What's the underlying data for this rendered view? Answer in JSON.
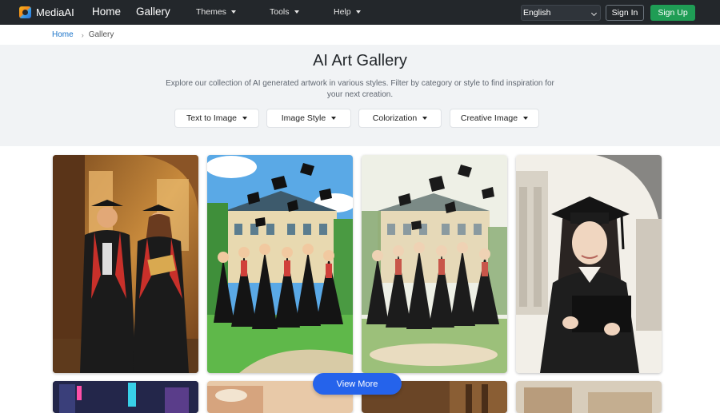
{
  "navbar": {
    "brand": "MediaAI",
    "main_links": [
      "Home",
      "Gallery"
    ],
    "dropdowns": [
      "Themes",
      "Tools",
      "Help"
    ],
    "language": "English",
    "sign_in": "Sign In",
    "sign_up": "Sign Up"
  },
  "breadcrumb": {
    "home": "Home",
    "separator": "›",
    "current": "Gallery"
  },
  "hero": {
    "title": "AI Art Gallery",
    "description": "Explore our collection of AI generated artwork in various styles. Filter by category or style to find inspiration for your next creation.",
    "filters": [
      "Text to Image",
      "Image Style",
      "Colorization",
      "Creative Image"
    ]
  },
  "gallery": {
    "cards": [
      {
        "icon": "graduation-couple-painting"
      },
      {
        "icon": "cap-toss-cartoon"
      },
      {
        "icon": "cap-toss-watercolor"
      },
      {
        "icon": "graduate-portrait-ink"
      }
    ],
    "view_more": "View More"
  },
  "colors": {
    "navbar_bg": "#23272b",
    "sign_up_green": "#1f9d55",
    "link_blue": "#1a73c9",
    "view_more_blue": "#2563eb",
    "hero_bg": "#f1f3f5"
  }
}
